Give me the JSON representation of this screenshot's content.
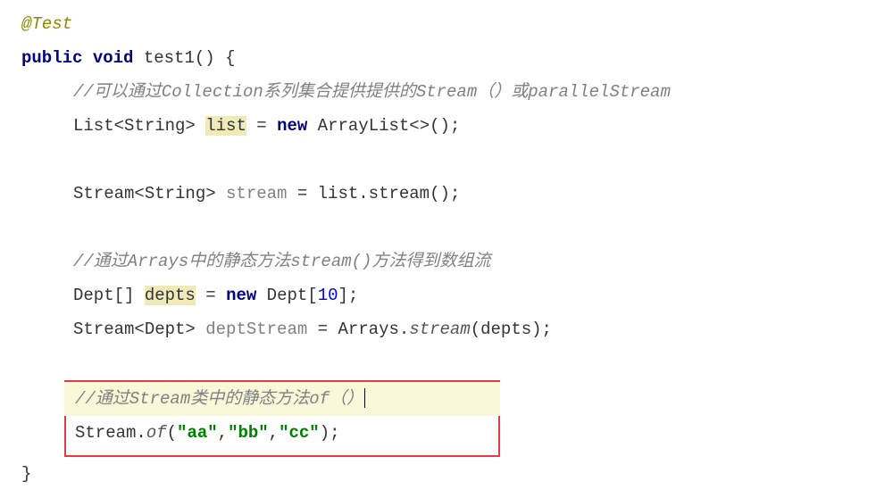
{
  "code": {
    "annotation": "@Test",
    "method_sig": {
      "mod_public": "public",
      "mod_void": "void",
      "name": "test1",
      "parens_brace": "() {"
    },
    "line_comment1": "//可以通过Collection系列集合提供提供的Stream（）或parallelStream",
    "line_list_decl": {
      "type_part": "List<String> ",
      "var": "list",
      "eq": " = ",
      "new_kw": "new",
      "ctor": " ArrayList<>();"
    },
    "line_stream_decl": {
      "type_part": "Stream<String> ",
      "var": "stream",
      "rest": " = list.stream();"
    },
    "line_comment2": "//通过Arrays中的静态方法stream()方法得到数组流",
    "line_depts": {
      "type_part": "Dept[] ",
      "var": "depts",
      "eq": " = ",
      "new_kw": "new",
      "arr_part1": " Dept[",
      "num": "10",
      "arr_part2": "];"
    },
    "line_deptstream": {
      "type_part": "Stream<Dept> ",
      "var": "deptStream",
      "eq": " = Arrays.",
      "method": "stream",
      "rest": "(depts);"
    },
    "line_comment3": "//通过Stream类中的静态方法of（）",
    "line_streamof": {
      "cls": "Stream.",
      "method": "of",
      "open": "(",
      "s1": "\"aa\"",
      "c1": ",",
      "s2": "\"bb\"",
      "c2": ",",
      "s3": "\"cc\"",
      "close": ");"
    },
    "close_brace": "}"
  }
}
